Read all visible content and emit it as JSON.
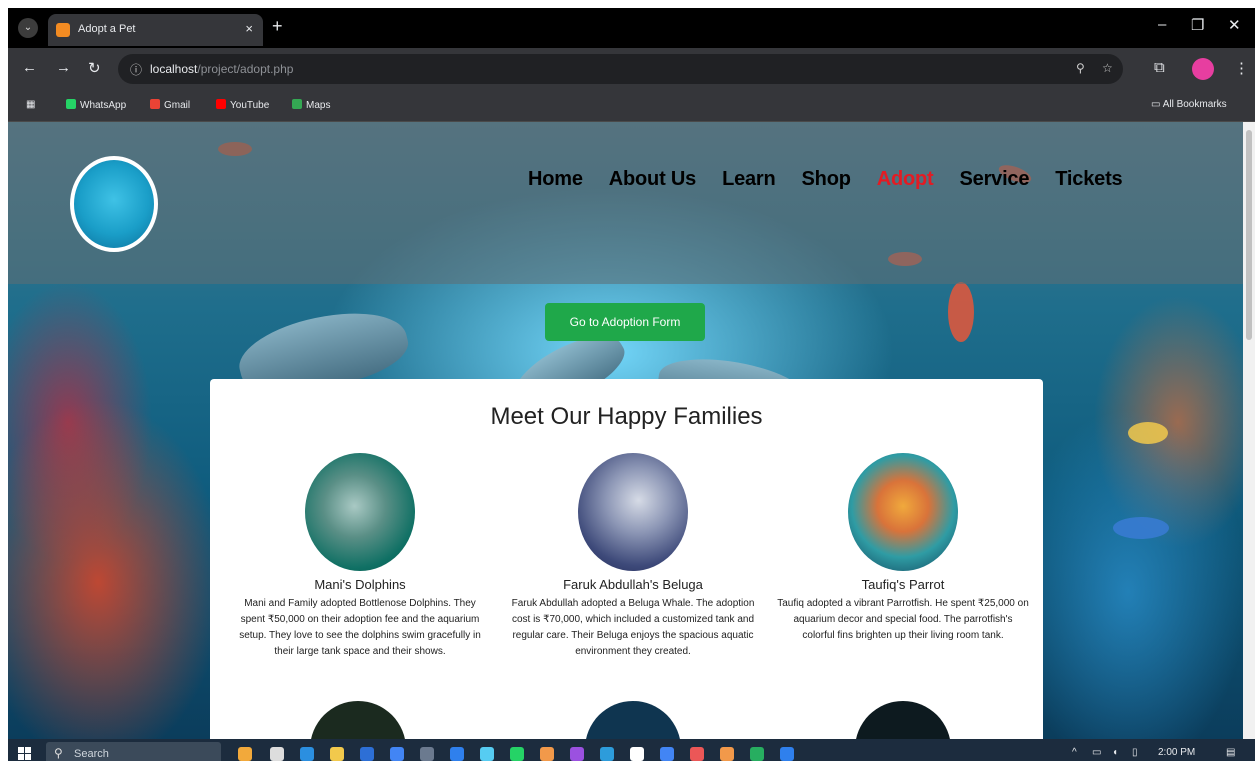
{
  "browser": {
    "tab_title": "Adopt a Pet",
    "tab_close": "×",
    "new_tab": "+",
    "menu_icon": "⌄",
    "win_minimize": "–",
    "win_restore": "❐",
    "win_close": "✕",
    "url_host": "localhost",
    "url_path": "/project/adopt.php",
    "bookmarks": [
      "WhatsApp",
      "Gmail",
      "YouTube",
      "Maps"
    ],
    "all_bookmarks": "All Bookmarks"
  },
  "site": {
    "nav": [
      "Home",
      "About Us",
      "Learn",
      "Shop",
      "Adopt",
      "Service",
      "Tickets"
    ],
    "active_nav": "Adopt",
    "cta": "Go to Adoption Form",
    "section_title": "Meet Our Happy Families",
    "families": [
      {
        "name": "Mani's Dolphins",
        "desc": "Mani and Family adopted Bottlenose Dolphins. They spent ₹50,000 on their adoption fee and the aquarium setup. They love to see the dolphins swim gracefully in their large tank space and their shows."
      },
      {
        "name": "Faruk Abdullah's Beluga",
        "desc": "Faruk Abdullah adopted a Beluga Whale. The adoption cost is ₹70,000, which included a customized tank and regular care. Their Beluga enjoys the spacious aquatic environment they created."
      },
      {
        "name": "Taufiq's Parrot",
        "desc": "Taufiq adopted a vibrant Parrotfish. He spent ₹25,000 on aquarium decor and special food. The parrotfish's colorful fins brighten up their living room tank."
      }
    ]
  },
  "taskbar": {
    "search": "Search",
    "time": "2:00 PM"
  }
}
